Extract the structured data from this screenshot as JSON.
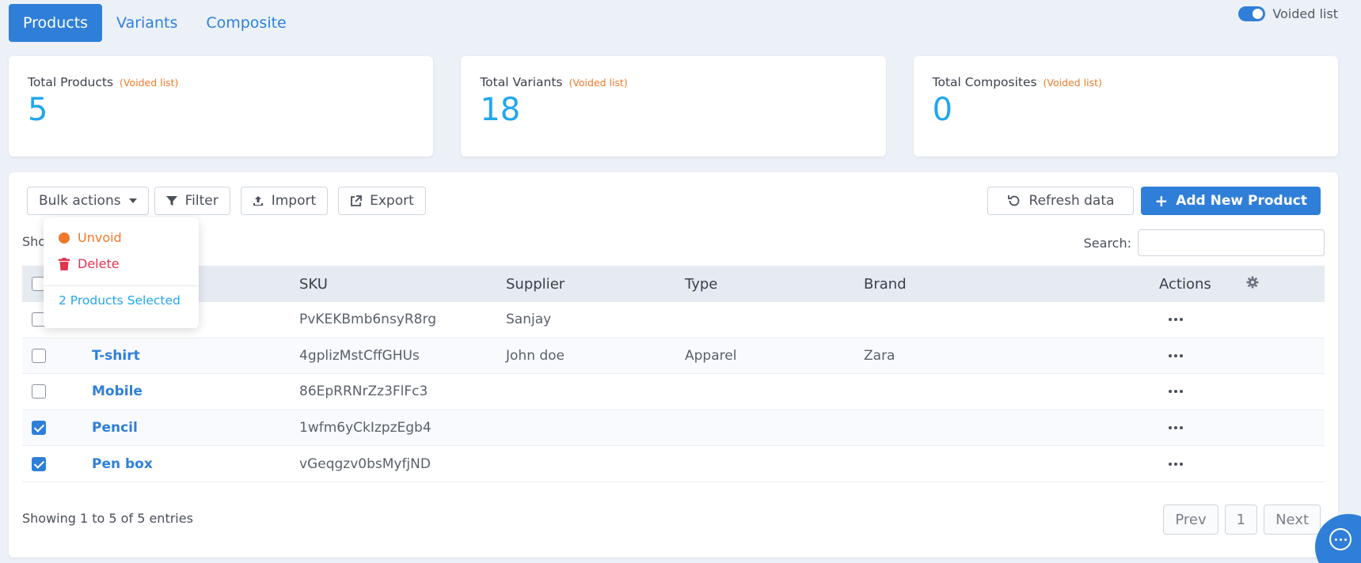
{
  "tabs": [
    {
      "label": "Products",
      "active": true
    },
    {
      "label": "Variants",
      "active": false
    },
    {
      "label": "Composite",
      "active": false
    }
  ],
  "voided_toggle": {
    "label": "Voided list",
    "on": true
  },
  "cards": [
    {
      "title": "Total Products",
      "sub": "(Voided list)",
      "value": "5"
    },
    {
      "title": "Total Variants",
      "sub": "(Voided list)",
      "value": "18"
    },
    {
      "title": "Total Composites",
      "sub": "(Voided list)",
      "value": "0"
    }
  ],
  "toolbar": {
    "bulk_actions": "Bulk actions",
    "filter": "Filter",
    "import": "Import",
    "export": "Export",
    "refresh": "Refresh data",
    "add_new": "Add New Product"
  },
  "dropdown": {
    "unvoid": "Unvoid",
    "delete": "Delete",
    "selected": "2 Products Selected"
  },
  "show_label": "Sho",
  "search": {
    "label": "Search:",
    "value": ""
  },
  "table": {
    "columns": [
      "SKU",
      "Supplier",
      "Type",
      "Brand",
      "Actions"
    ],
    "rows": [
      {
        "name": "",
        "sku": "PvKEKBmb6nsyR8rg",
        "supplier": "Sanjay",
        "type": "",
        "brand": "",
        "checked": false
      },
      {
        "name": "T-shirt",
        "sku": "4gplizMstCffGHUs",
        "supplier": "John doe",
        "type": "Apparel",
        "brand": "Zara",
        "checked": false
      },
      {
        "name": "Mobile",
        "sku": "86EpRRNrZz3FlFc3",
        "supplier": "",
        "type": "",
        "brand": "",
        "checked": false
      },
      {
        "name": "Pencil",
        "sku": "1wfm6yCkIzpzEgb4",
        "supplier": "",
        "type": "",
        "brand": "",
        "checked": true
      },
      {
        "name": "Pen box",
        "sku": "vGeqgzv0bsMyfjND",
        "supplier": "",
        "type": "",
        "brand": "",
        "checked": true
      }
    ]
  },
  "footer": {
    "info": "Showing 1 to 5 of 5 entries",
    "prev": "Prev",
    "page": "1",
    "next": "Next"
  },
  "colors": {
    "primary": "#2f7fd8",
    "accent": "#22a6ee",
    "warning": "#f07a2b",
    "danger": "#e0364f"
  }
}
